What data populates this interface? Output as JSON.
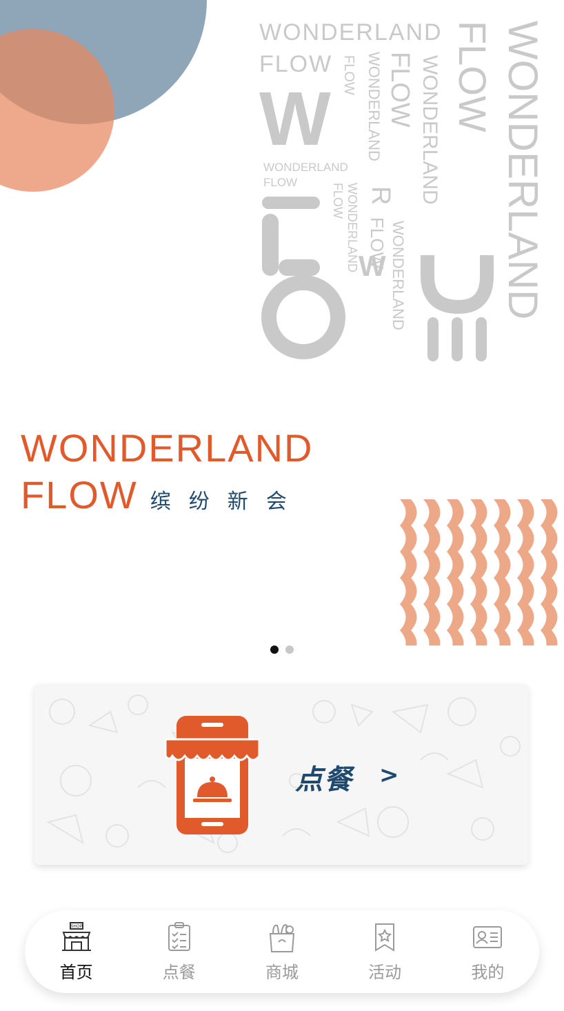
{
  "banner": {
    "logo_line1": "WONDERLAND",
    "logo_line2": "FLOW",
    "logo_cn": "缤纷新会",
    "deco_text": "WONDERLAND",
    "deco_text_flow": "FLOW",
    "slides_total": 2,
    "active_slide": 1
  },
  "order_card": {
    "label": "点餐",
    "arrow": ">"
  },
  "tabbar": {
    "items": [
      {
        "label": "首页",
        "icon": "shop-icon",
        "active": true
      },
      {
        "label": "点餐",
        "icon": "clipboard-icon",
        "active": false
      },
      {
        "label": "商城",
        "icon": "grocery-bag-icon",
        "active": false
      },
      {
        "label": "活动",
        "icon": "bookmark-star-icon",
        "active": false
      },
      {
        "label": "我的",
        "icon": "id-card-icon",
        "active": false
      }
    ]
  },
  "colors": {
    "brand_orange": "#e05a2b",
    "brand_navy": "#1f4a6e",
    "peach": "#e8a080",
    "blue_grey": "#8fa6b8"
  }
}
